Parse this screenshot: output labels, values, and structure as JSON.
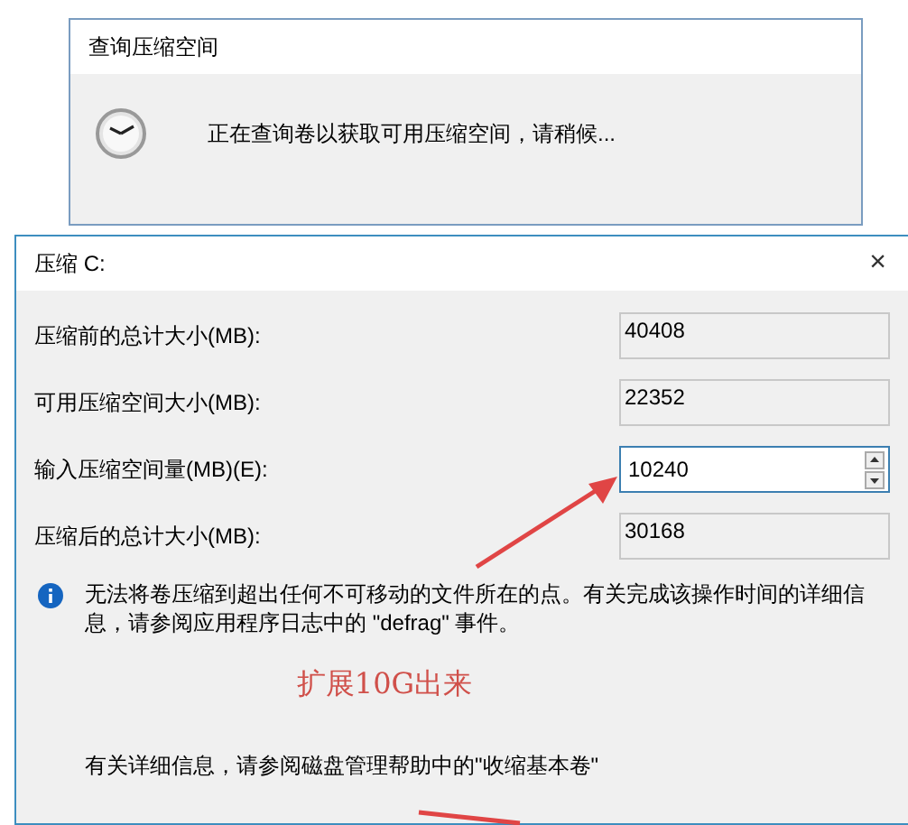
{
  "query_dialog": {
    "title": "查询压缩空间",
    "message": "正在查询卷以获取可用压缩空间，请稍候..."
  },
  "shrink_dialog": {
    "title": "压缩 C:",
    "close": "×",
    "fields": [
      {
        "label": "压缩前的总计大小(MB):",
        "value": "40408",
        "kind": "readonly"
      },
      {
        "label": "可用压缩空间大小(MB):",
        "value": "22352",
        "kind": "readonly"
      },
      {
        "label": "输入压缩空间量(MB)(E):",
        "value": "10240",
        "kind": "spin"
      },
      {
        "label": "压缩后的总计大小(MB):",
        "value": "30168",
        "kind": "readonly"
      }
    ],
    "info": "无法将卷压缩到超出任何不可移动的文件所在的点。有关完成该操作时间的详细信息，请参阅应用程序日志中的 \"defrag\" 事件。",
    "help": "有关详细信息，请参阅磁盘管理帮助中的\"收缩基本卷\""
  },
  "annotation": {
    "text": "扩展10G出来"
  }
}
